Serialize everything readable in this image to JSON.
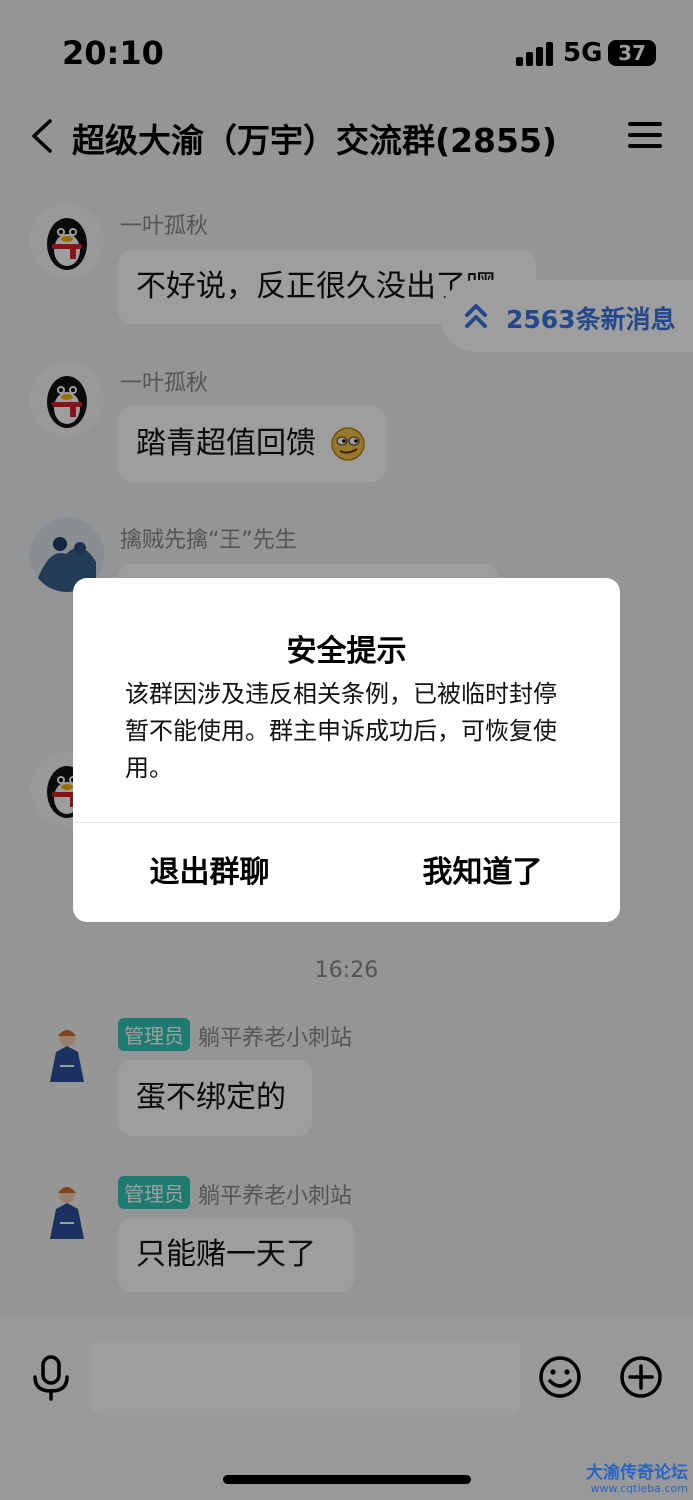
{
  "status_bar": {
    "time": "20:10",
    "network": "5G",
    "battery": "37"
  },
  "nav": {
    "title": "超级大渝（万宇）交流群(2855)"
  },
  "new_messages": {
    "label": "2563条新消息"
  },
  "messages": [
    {
      "sender": "一叶孤秋",
      "text": "不好说，反正很久没出了嘿"
    },
    {
      "sender": "一叶孤秋",
      "text": "踏青超值回馈"
    },
    {
      "sender": "擒贼先擒“王”先生"
    },
    {
      "time": "16:26"
    },
    {
      "badge": "管理员",
      "sender": "躺平养老小刺站",
      "text": "蛋不绑定的"
    },
    {
      "badge": "管理员",
      "sender": "躺平养老小刺站",
      "text": "只能赌一天了"
    }
  ],
  "dialog": {
    "title": "安全提示",
    "message": "该群因涉及违反相关条例，已被临时封停暂不能使用。群主申诉成功后，可恢复使用。",
    "buttons": {
      "exit": "退出群聊",
      "ok": "我知道了"
    }
  },
  "watermark": {
    "name": "大渝传奇论坛",
    "url": "www.cqtieba.com"
  },
  "colors": {
    "overlay": "rgba(0,0,0,0.38)",
    "accent": "#3a74e0",
    "badge": "#2fc7b8"
  }
}
